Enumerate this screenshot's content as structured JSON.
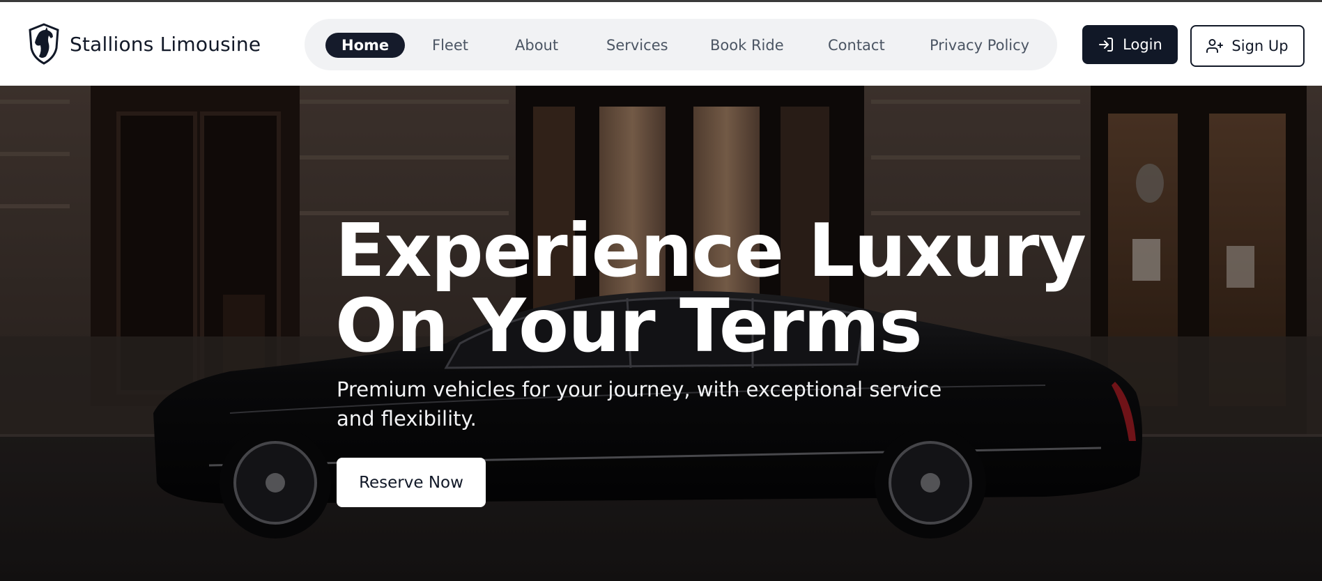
{
  "brand": {
    "name": "Stallions Limousine",
    "logo_icon": "horse-shield-icon"
  },
  "nav": {
    "items": [
      {
        "label": "Home",
        "active": true
      },
      {
        "label": "Fleet",
        "active": false
      },
      {
        "label": "About",
        "active": false
      },
      {
        "label": "Services",
        "active": false
      },
      {
        "label": "Book Ride",
        "active": false
      },
      {
        "label": "Contact",
        "active": false
      },
      {
        "label": "Privacy Policy",
        "active": false
      }
    ]
  },
  "auth": {
    "login_label": "Login",
    "login_icon": "login-arrow-icon",
    "signup_label": "Sign Up",
    "signup_icon": "user-plus-icon"
  },
  "hero": {
    "title_line1": "Experience Luxury",
    "title_line2": "On Your Terms",
    "subtitle": "Premium vehicles for your journey, with exceptional service and flexibility.",
    "cta_label": "Reserve Now",
    "background_image": "black-limousine-in-front-of-hotel-entrance"
  },
  "colors": {
    "primary": "#111827",
    "nav_bg": "#f1f2f4",
    "nav_text": "#4b5563",
    "white": "#ffffff"
  }
}
